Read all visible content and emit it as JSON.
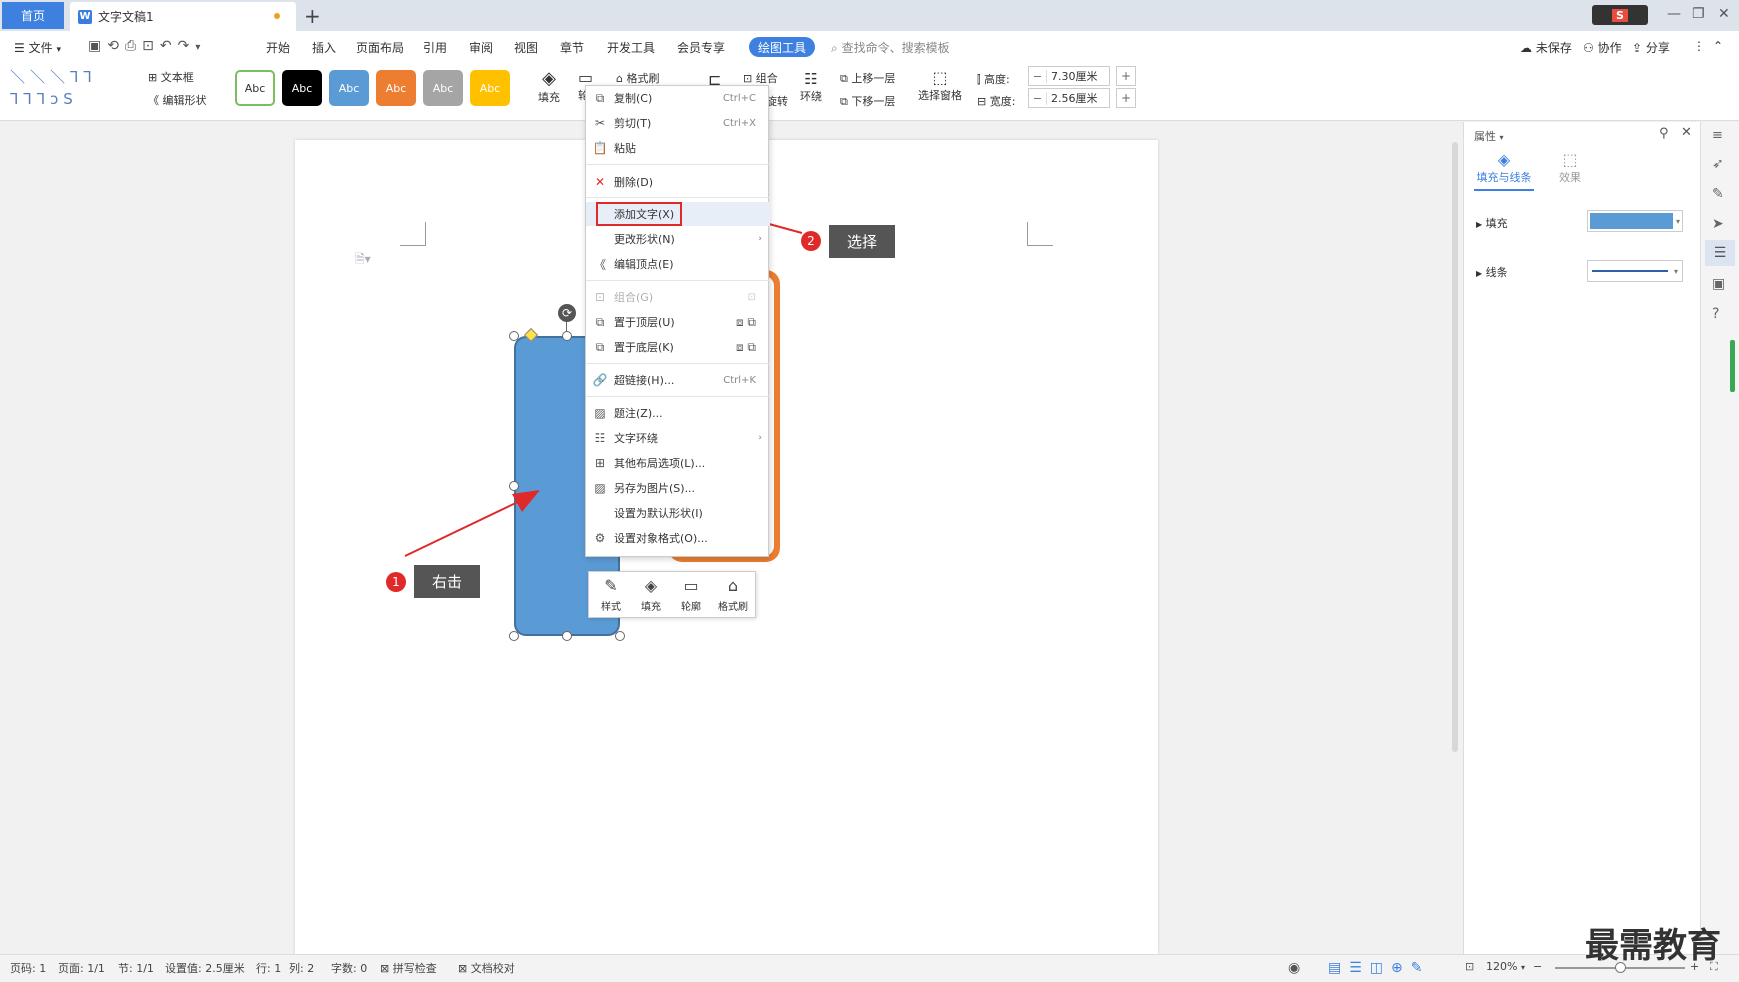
{
  "titlebar": {
    "home_tab": "首页",
    "doc_icon": "W",
    "doc_tab": "文字文稿1",
    "new_tab": "+",
    "app_badge": "S",
    "minimize": "—",
    "restore": "❐",
    "close": "✕"
  },
  "menubar": {
    "file": "文件",
    "items": [
      "开始",
      "插入",
      "页面布局",
      "引用",
      "审阅",
      "视图",
      "章节",
      "开发工具",
      "会员专享"
    ],
    "active_tab": "绘图工具",
    "search_placeholder": "查找命令、搜索模板",
    "unsaved": "未保存",
    "collab": "协作",
    "share": "分享"
  },
  "ribbon": {
    "textbox": "文本框",
    "edit_shape": "编辑形状",
    "style_label": "Abc",
    "style_colors": [
      "#ffffff",
      "#000000",
      "#5b9bd5",
      "#ed7d31",
      "#a5a5a5",
      "#ffc000"
    ],
    "fill": "填充",
    "outline_short": "轮",
    "format_painter": "格式刷",
    "group": "组合",
    "rotate_short": "旋转",
    "wrap": "环绕",
    "bring_forward": "上移一层",
    "send_backward": "下移一层",
    "select_pane": "选择窗格",
    "height_label": "高度:",
    "height_value": "7.30厘米",
    "width_label": "宽度:",
    "width_value": "2.56厘米",
    "minus": "−",
    "plus": "+"
  },
  "context_menu": {
    "items": [
      {
        "label": "复制(C)",
        "shortcut": "Ctrl+C",
        "icon": "copy-icon"
      },
      {
        "label": "剪切(T)",
        "shortcut": "Ctrl+X",
        "icon": "cut-icon"
      },
      {
        "label": "粘贴",
        "shortcut": "",
        "icon": "paste-icon"
      },
      {
        "label": "删除(D)",
        "shortcut": "",
        "icon": "delete-icon"
      },
      {
        "label": "添加文字(X)",
        "shortcut": "",
        "icon": ""
      },
      {
        "label": "更改形状(N)",
        "shortcut": "",
        "icon": ""
      },
      {
        "label": "编辑顶点(E)",
        "shortcut": "",
        "icon": "edit-points-icon"
      },
      {
        "label": "组合(G)",
        "shortcut": "",
        "icon": "group-icon"
      },
      {
        "label": "置于顶层(U)",
        "shortcut": "",
        "icon": "bring-front-icon"
      },
      {
        "label": "置于底层(K)",
        "shortcut": "",
        "icon": "send-back-icon"
      },
      {
        "label": "超链接(H)...",
        "shortcut": "Ctrl+K",
        "icon": "link-icon"
      },
      {
        "label": "题注(Z)...",
        "shortcut": "",
        "icon": "caption-icon"
      },
      {
        "label": "文字环绕",
        "shortcut": "",
        "icon": "wrap-icon"
      },
      {
        "label": "其他布局选项(L)...",
        "shortcut": "",
        "icon": "layout-icon"
      },
      {
        "label": "另存为图片(S)...",
        "shortcut": "",
        "icon": "save-image-icon"
      },
      {
        "label": "设置为默认形状(I)",
        "shortcut": "",
        "icon": ""
      },
      {
        "label": "设置对象格式(O)...",
        "shortcut": "",
        "icon": "format-object-icon"
      }
    ]
  },
  "float_toolbar": {
    "style": "样式",
    "fill": "填充",
    "outline": "轮廓",
    "painter": "格式刷"
  },
  "callouts": {
    "step1_num": "1",
    "step1_text": "右击",
    "step2_num": "2",
    "step2_text": "选择"
  },
  "properties": {
    "title": "属性",
    "tab_fill_line": "填充与线条",
    "tab_effect": "效果",
    "fill": "填充",
    "line": "线条",
    "fill_color": "#5b9bd5",
    "line_color": "#2e5fa8"
  },
  "statusbar": {
    "page_code": "页码: 1",
    "page": "页面: 1/1",
    "section": "节: 1/1",
    "setting": "设置值: 2.5厘米",
    "row": "行: 1",
    "col": "列: 2",
    "words": "字数: 0",
    "spell": "拼写检查",
    "proof": "文档校对",
    "zoom": "120%"
  },
  "watermark": "最需教育",
  "colors": {
    "accent": "#3e80e0",
    "shape_blue": "#5b9bd5",
    "shape_orange": "#ed7d31",
    "highlight_red": "#e02a2a"
  }
}
